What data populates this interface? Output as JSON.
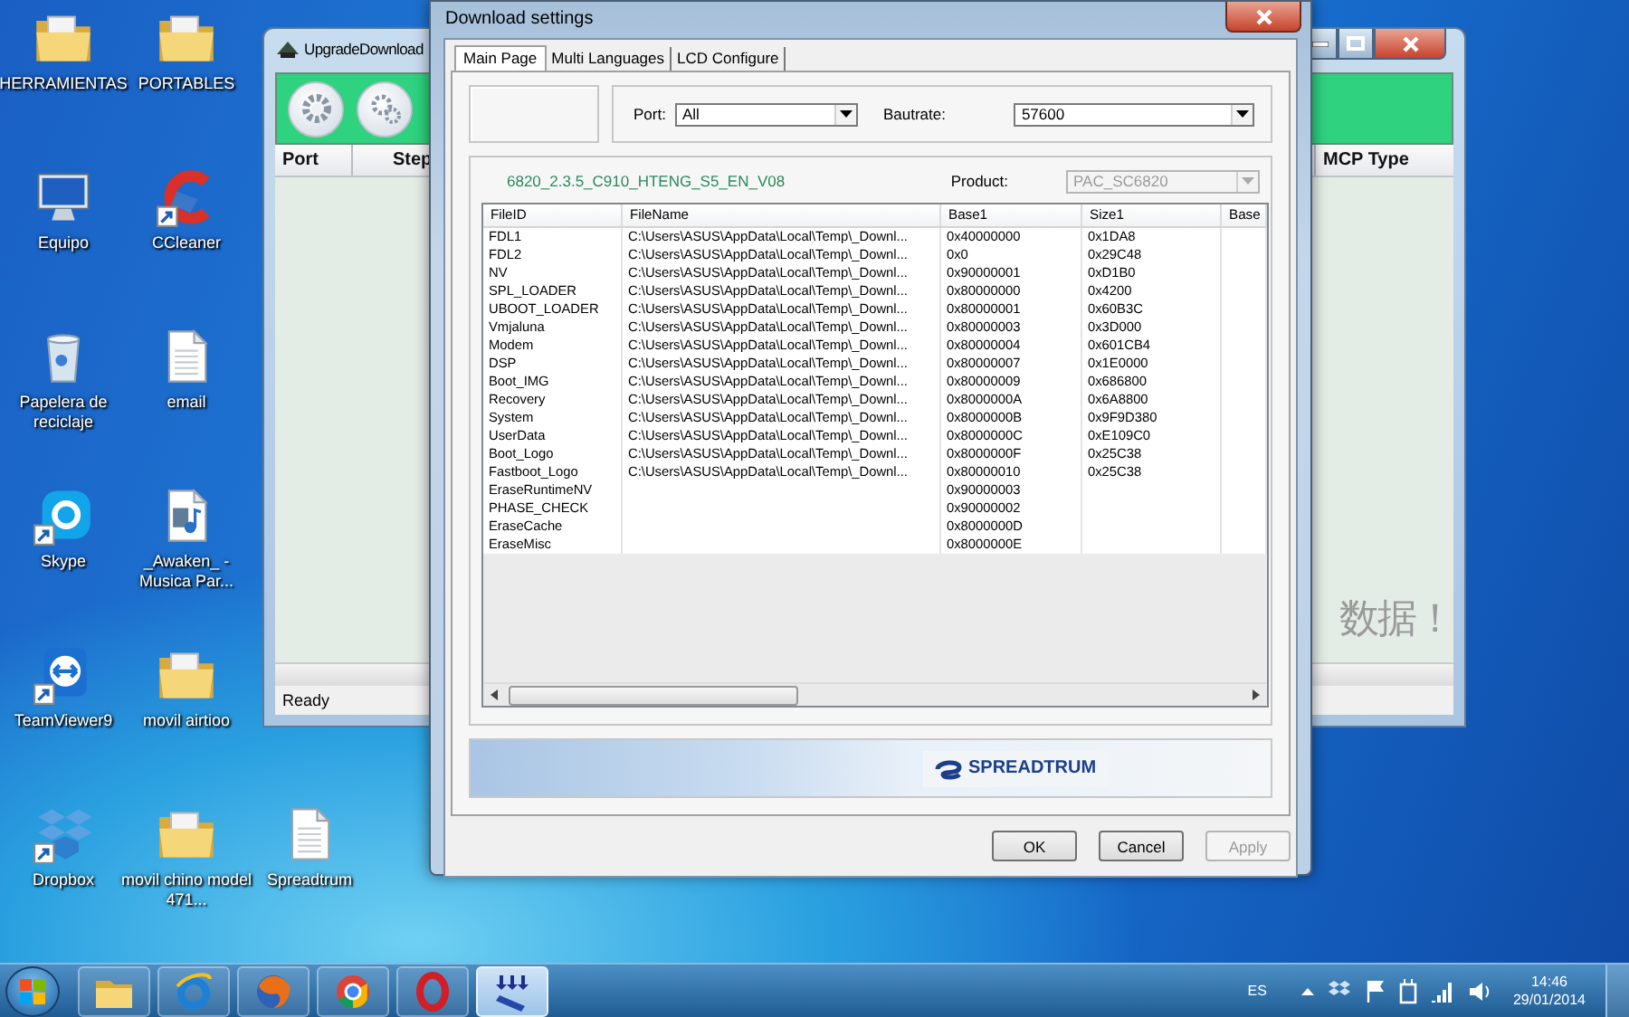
{
  "desktop_icons": [
    {
      "label": "HERRAMIENTAS",
      "kind": "folder"
    },
    {
      "label": "PORTABLES",
      "kind": "folder"
    },
    {
      "label": "Equipo",
      "kind": "computer"
    },
    {
      "label": "CCleaner",
      "kind": "ccleaner"
    },
    {
      "label": "Papelera de reciclaje",
      "kind": "recycle"
    },
    {
      "label": "email",
      "kind": "document"
    },
    {
      "label": "Skype",
      "kind": "skype"
    },
    {
      "label": "_Awaken_ - Musica Par...",
      "kind": "audio"
    },
    {
      "label": "TeamViewer9",
      "kind": "teamviewer"
    },
    {
      "label": "movil airtioo",
      "kind": "folder"
    },
    {
      "label": "Dropbox",
      "kind": "dropbox"
    },
    {
      "label": "movil chino model 471...",
      "kind": "folder"
    },
    {
      "label": "Spreadtrum",
      "kind": "document"
    }
  ],
  "background_window": {
    "title": "UpgradeDownload",
    "columns": [
      "Port",
      "Step",
      "MCP Type"
    ],
    "message": "数据！",
    "status": "Ready"
  },
  "dialog": {
    "title": "Download settings",
    "tabs": [
      {
        "label": "Main Page",
        "selected": true
      },
      {
        "label": "Multi Languages",
        "selected": false
      },
      {
        "label": "LCD Configure",
        "selected": false
      }
    ],
    "port": {
      "label": "Port:",
      "value": "All"
    },
    "baudrate": {
      "label": "Bautrate:",
      "value": "57600"
    },
    "package": "6820_2.3.5_C910_HTENG_S5_EN_V08",
    "product": {
      "label": "Product:",
      "value": "PAC_SC6820",
      "disabled": true
    },
    "table": {
      "columns": [
        "FileID",
        "FileName",
        "Base1",
        "Size1",
        "Base"
      ],
      "rows": [
        {
          "file_id": "FDL1",
          "file_name": "C:\\Users\\ASUS\\AppData\\Local\\Temp\\_Downl...",
          "base1": "0x40000000",
          "size1": "0x1DA8"
        },
        {
          "file_id": "FDL2",
          "file_name": "C:\\Users\\ASUS\\AppData\\Local\\Temp\\_Downl...",
          "base1": "0x0",
          "size1": "0x29C48"
        },
        {
          "file_id": "NV",
          "file_name": "C:\\Users\\ASUS\\AppData\\Local\\Temp\\_Downl...",
          "base1": "0x90000001",
          "size1": "0xD1B0"
        },
        {
          "file_id": "SPL_LOADER",
          "file_name": "C:\\Users\\ASUS\\AppData\\Local\\Temp\\_Downl...",
          "base1": "0x80000000",
          "size1": "0x4200"
        },
        {
          "file_id": "UBOOT_LOADER",
          "file_name": "C:\\Users\\ASUS\\AppData\\Local\\Temp\\_Downl...",
          "base1": "0x80000001",
          "size1": "0x60B3C"
        },
        {
          "file_id": "Vmjaluna",
          "file_name": "C:\\Users\\ASUS\\AppData\\Local\\Temp\\_Downl...",
          "base1": "0x80000003",
          "size1": "0x3D000"
        },
        {
          "file_id": "Modem",
          "file_name": "C:\\Users\\ASUS\\AppData\\Local\\Temp\\_Downl...",
          "base1": "0x80000004",
          "size1": "0x601CB4"
        },
        {
          "file_id": "DSP",
          "file_name": "C:\\Users\\ASUS\\AppData\\Local\\Temp\\_Downl...",
          "base1": "0x80000007",
          "size1": "0x1E0000"
        },
        {
          "file_id": "Boot_IMG",
          "file_name": "C:\\Users\\ASUS\\AppData\\Local\\Temp\\_Downl...",
          "base1": "0x80000009",
          "size1": "0x686800"
        },
        {
          "file_id": "Recovery",
          "file_name": "C:\\Users\\ASUS\\AppData\\Local\\Temp\\_Downl...",
          "base1": "0x8000000A",
          "size1": "0x6A8800"
        },
        {
          "file_id": "System",
          "file_name": "C:\\Users\\ASUS\\AppData\\Local\\Temp\\_Downl...",
          "base1": "0x8000000B",
          "size1": "0x9F9D380"
        },
        {
          "file_id": "UserData",
          "file_name": "C:\\Users\\ASUS\\AppData\\Local\\Temp\\_Downl...",
          "base1": "0x8000000C",
          "size1": "0xE109C0"
        },
        {
          "file_id": "Boot_Logo",
          "file_name": "C:\\Users\\ASUS\\AppData\\Local\\Temp\\_Downl...",
          "base1": "0x8000000F",
          "size1": "0x25C38"
        },
        {
          "file_id": "Fastboot_Logo",
          "file_name": "C:\\Users\\ASUS\\AppData\\Local\\Temp\\_Downl...",
          "base1": "0x80000010",
          "size1": "0x25C38"
        },
        {
          "file_id": "EraseRuntimeNV",
          "base1": "0x90000003"
        },
        {
          "file_id": "PHASE_CHECK",
          "base1": "0x90000002"
        },
        {
          "file_id": "EraseCache",
          "base1": "0x8000000D"
        },
        {
          "file_id": "EraseMisc",
          "base1": "0x8000000E"
        }
      ]
    },
    "logo": "SPREADTRUM",
    "buttons": [
      {
        "label": "OK",
        "disabled": false
      },
      {
        "label": "Cancel",
        "disabled": false
      },
      {
        "label": "Apply",
        "disabled": true
      }
    ]
  },
  "taskbar": {
    "apps": [
      {
        "kind": "explorer",
        "active": false
      },
      {
        "kind": "ie",
        "active": false
      },
      {
        "kind": "firefox",
        "active": false
      },
      {
        "kind": "chrome",
        "active": false
      },
      {
        "kind": "opera",
        "active": false
      },
      {
        "kind": "download",
        "active": true
      }
    ],
    "language": "ES",
    "time": "14:46",
    "date": "29/01/2014"
  }
}
